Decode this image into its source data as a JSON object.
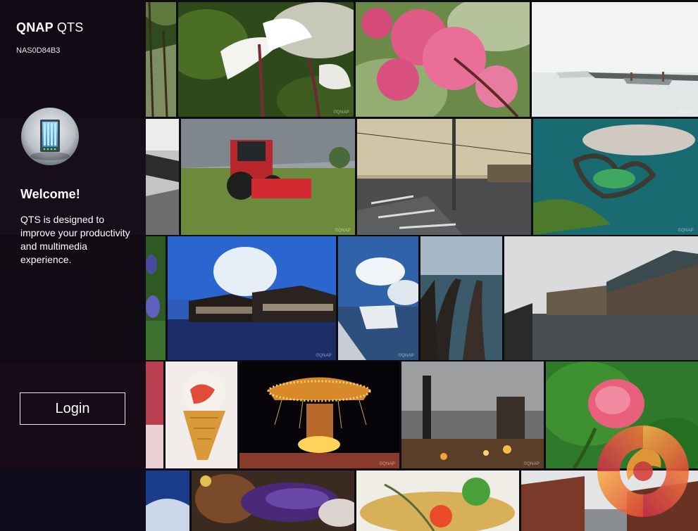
{
  "brand": {
    "name": "QNAP",
    "product": "QTS"
  },
  "device": {
    "hostname": "NAS0D84B3"
  },
  "welcome": {
    "title": "Welcome!",
    "description": "QTS is designed to improve your productivity and multimedia experience."
  },
  "login": {
    "label": "Login"
  },
  "icons": {
    "nas": "nas-device-icon",
    "watermark_logo": "kitguru-logo-icon"
  },
  "colors": {
    "panel": "#100814",
    "login_border": "#e9e6ee",
    "text": "#ffffff"
  }
}
